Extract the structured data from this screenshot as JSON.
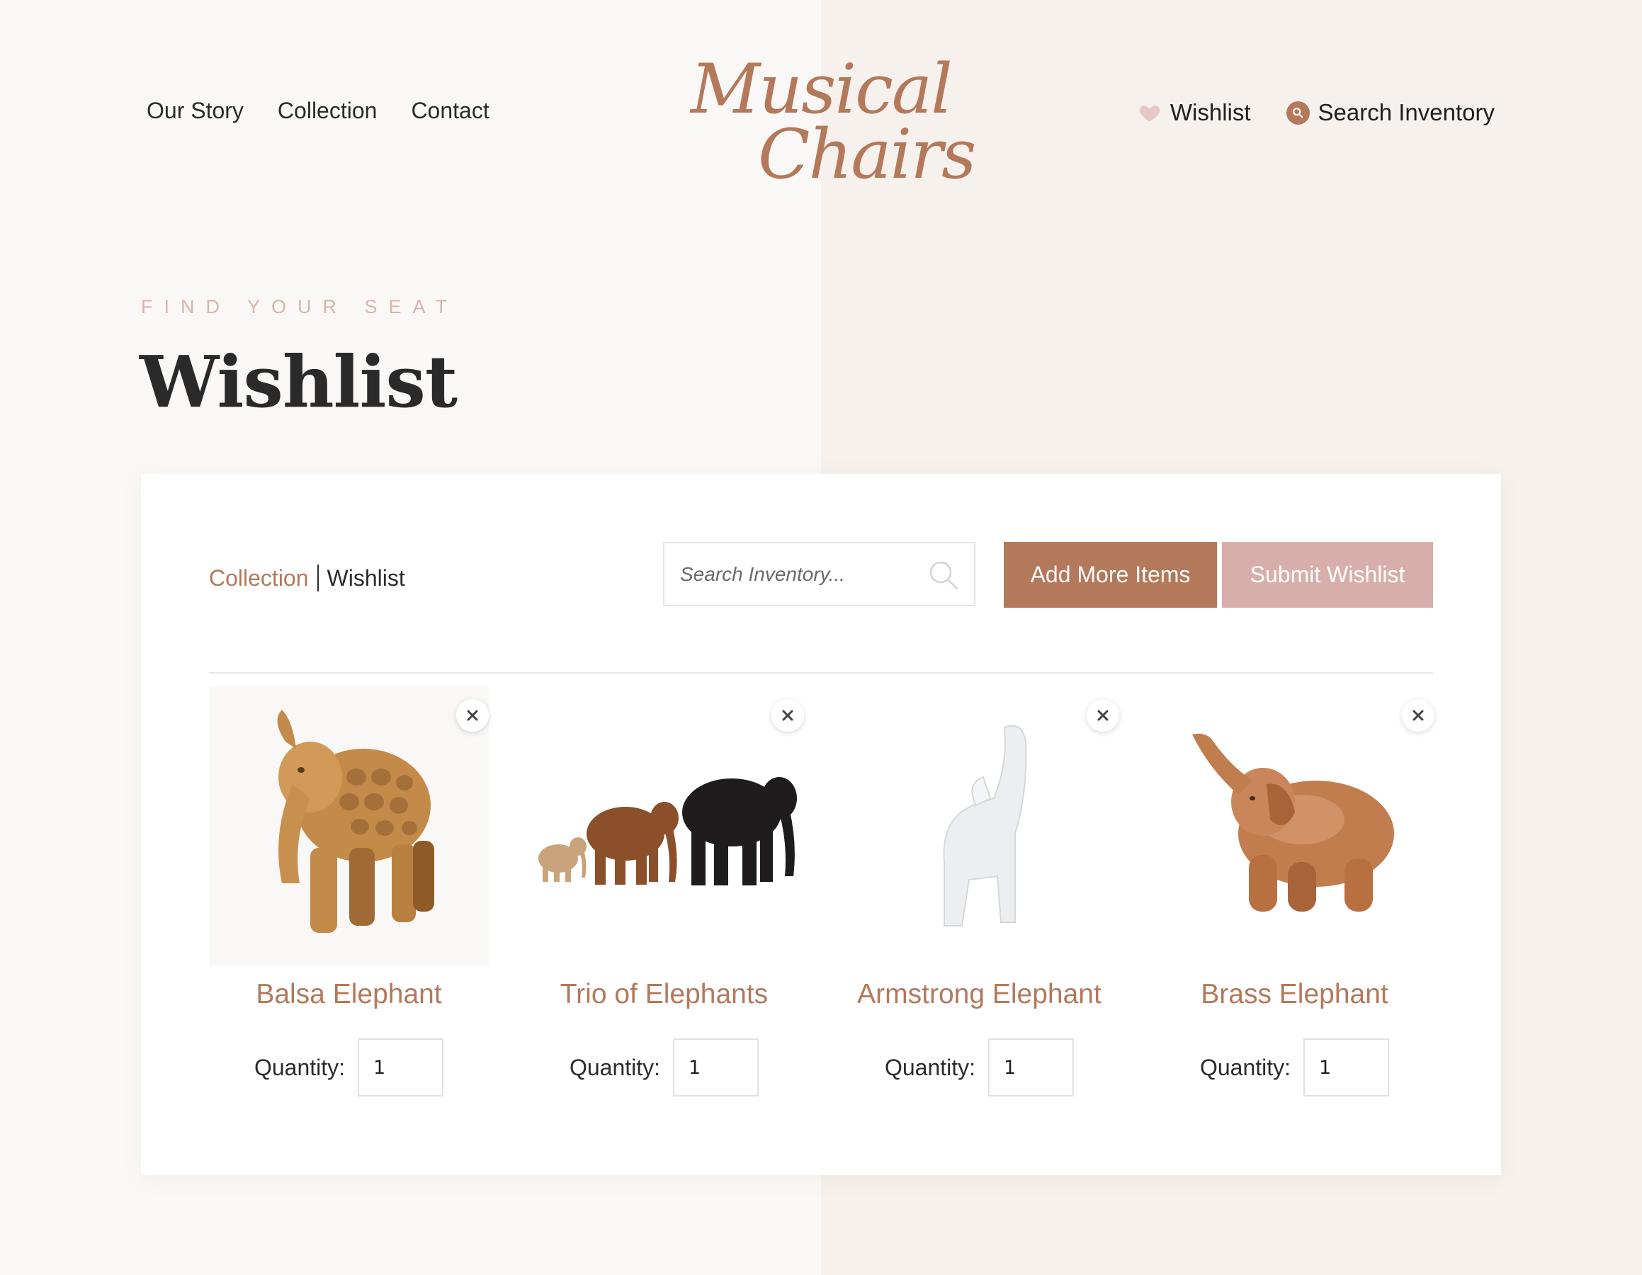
{
  "header": {
    "nav_left": [
      {
        "label": "Our Story"
      },
      {
        "label": "Collection"
      },
      {
        "label": "Contact"
      }
    ],
    "logo": {
      "line1": "Musical",
      "line2": "Chairs"
    },
    "wishlist_label": "Wishlist",
    "search_label": "Search Inventory"
  },
  "page": {
    "eyebrow": "FIND YOUR SEAT",
    "title": "Wishlist"
  },
  "toolbar": {
    "breadcrumb": {
      "collection": "Collection",
      "current": "Wishlist"
    },
    "search_placeholder": "Search Inventory...",
    "add_button": "Add More Items",
    "submit_button": "Submit Wishlist"
  },
  "products": [
    {
      "name": "Balsa Elephant",
      "quantity_label": "Quantity:",
      "quantity": "1",
      "image": "carved-balsa-elephant"
    },
    {
      "name": "Trio of Elephants",
      "quantity_label": "Quantity:",
      "quantity": "1",
      "image": "three-elephant-figurines"
    },
    {
      "name": "Armstrong Elephant",
      "quantity_label": "Quantity:",
      "quantity": "1",
      "image": "white-ceramic-elephant"
    },
    {
      "name": "Brass Elephant",
      "quantity_label": "Quantity:",
      "quantity": "1",
      "image": "brass-elephant"
    }
  ],
  "colors": {
    "accent": "#b4785a",
    "pink": "#d8aeab",
    "eyebrow": "#d9b3ae",
    "background_left": "#faf8f6",
    "background_right": "#f6f1ed"
  }
}
